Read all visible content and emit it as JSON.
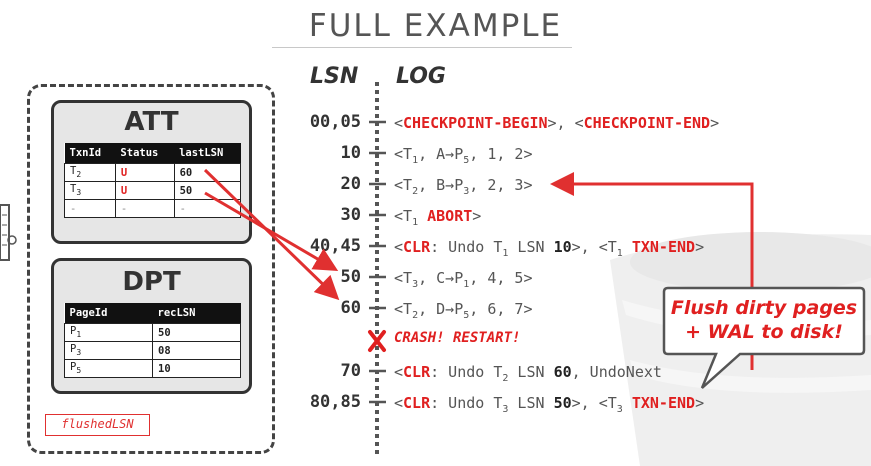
{
  "title": "FULL EXAMPLE",
  "headers": {
    "lsn": "LSN",
    "log": "LOG"
  },
  "att": {
    "title": "ATT",
    "columns": [
      "TxnId",
      "Status",
      "lastLSN"
    ],
    "rows": [
      {
        "txn": "T",
        "sub": "2",
        "status": "U",
        "last": "60"
      },
      {
        "txn": "T",
        "sub": "3",
        "status": "U",
        "last": "50"
      },
      {
        "txn": "-",
        "sub": "",
        "status": "-",
        "last": "-"
      }
    ]
  },
  "dpt": {
    "title": "DPT",
    "columns": [
      "PageId",
      "recLSN"
    ],
    "rows": [
      {
        "page": "P",
        "sub": "1",
        "rec": "50"
      },
      {
        "page": "P",
        "sub": "3",
        "rec": "08"
      },
      {
        "page": "P",
        "sub": "5",
        "rec": "10"
      }
    ]
  },
  "flushed_label": "flushedLSN",
  "log": [
    {
      "lsn": "00,05",
      "parts": [
        "<",
        "CHECKPOINT-BEGIN",
        ">, <",
        "CHECKPOINT-END",
        ">"
      ]
    },
    {
      "lsn": "10",
      "parts": [
        "<T",
        "1",
        ", A→P",
        "5",
        ", 1, 2>"
      ]
    },
    {
      "lsn": "20",
      "parts": [
        "<T",
        "2",
        ", B→P",
        "3",
        ", 2, 3>"
      ]
    },
    {
      "lsn": "30",
      "parts": [
        "<T",
        "1",
        " ",
        "ABORT",
        ">"
      ]
    },
    {
      "lsn": "40,45",
      "parts": [
        "<",
        "CLR",
        ": Undo T",
        "1",
        " LSN ",
        "10",
        ">, <T",
        "1",
        " ",
        "TXN-END",
        ">"
      ]
    },
    {
      "lsn": "50",
      "parts": [
        "<T",
        "3",
        ", C→P",
        "1",
        ", 4, 5>"
      ]
    },
    {
      "lsn": "60",
      "parts": [
        "<T",
        "2",
        ", D→P",
        "5",
        ", 6, 7>"
      ]
    },
    {
      "lsn": "70",
      "parts": [
        "<",
        "CLR",
        ": Undo T",
        "2",
        " LSN ",
        "60",
        ", UndoNext",
        "",
        ""
      ]
    },
    {
      "lsn": "80,85",
      "parts": [
        "<",
        "CLR",
        ": Undo T",
        "3",
        " LSN ",
        "50",
        ">, <T",
        "3",
        " ",
        "TXN-END",
        ">"
      ]
    }
  ],
  "crash_text": "CRASH! RESTART!",
  "callout": {
    "line1": "Flush dirty pages",
    "line2": "+ WAL to disk!"
  },
  "colors": {
    "accent": "#e02020",
    "text": "#555555",
    "dark": "#333333"
  }
}
